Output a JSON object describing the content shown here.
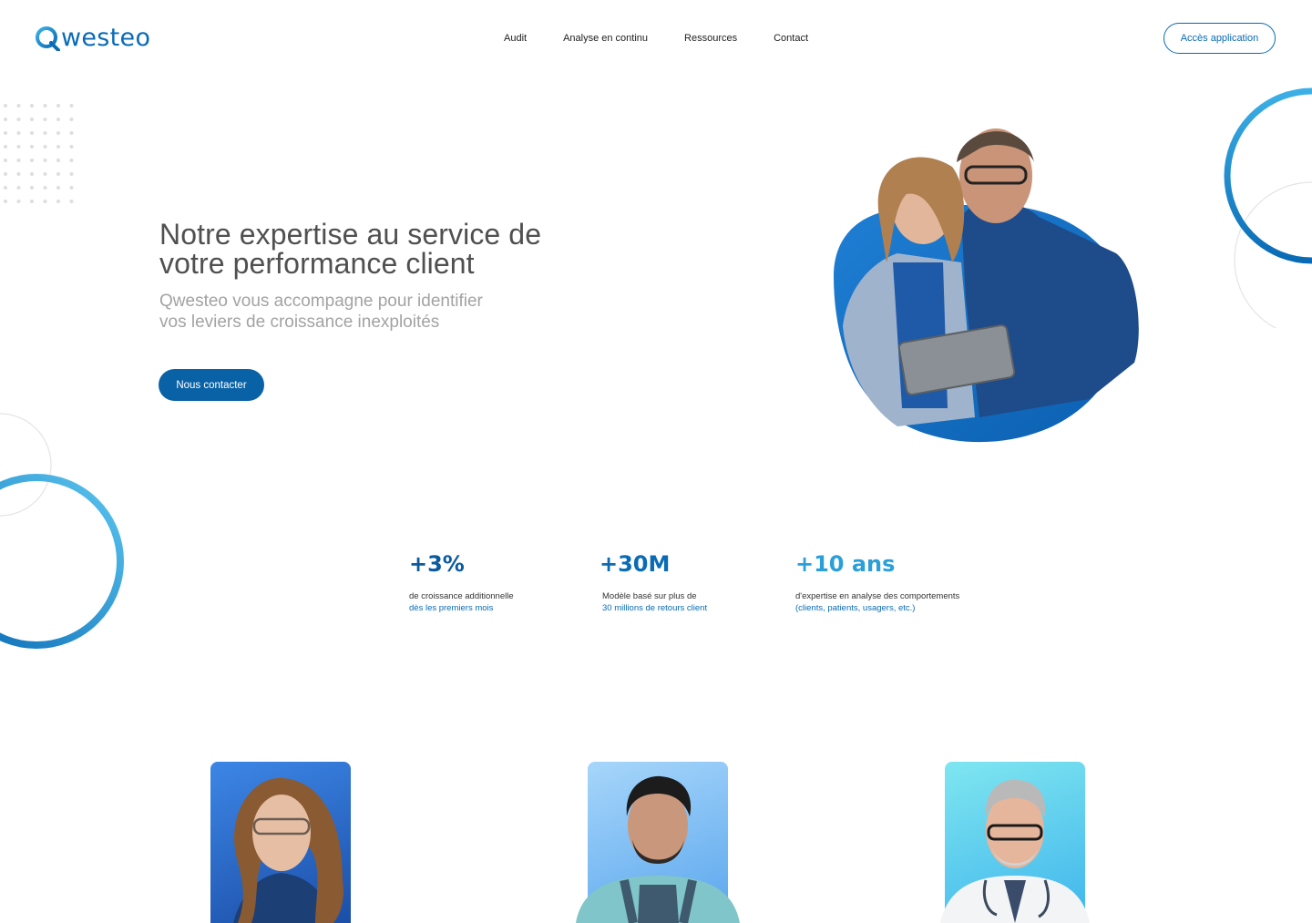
{
  "brand": {
    "name": "westeo",
    "accent": "#0a6bb5",
    "accent_light": "#3cb0e6"
  },
  "nav": {
    "items": [
      "Audit",
      "Analyse en continu",
      "Ressources",
      "Contact"
    ]
  },
  "header": {
    "app_button": "Accès application"
  },
  "hero": {
    "title_line1": "Notre expertise au service de",
    "title_line2": "votre performance client",
    "subtitle_line1": "Qwesteo vous accompagne pour identifier",
    "subtitle_line2": "vos leviers de croissance inexploités",
    "cta": "Nous contacter"
  },
  "stats": [
    {
      "value": "+3%",
      "line1": "de croissance additionnelle",
      "line2": "dès les premiers mois",
      "color": "#0a5aa0"
    },
    {
      "value": "+30M",
      "line1": "Modèle basé sur plus de",
      "line2": "30 millions de retours client",
      "color": "#0a6bb5"
    },
    {
      "value": "+10 ans",
      "line1": "d'expertise en analyse des comportements",
      "line2": "(clients, patients, usagers, etc.)",
      "color": "#2a9fd8"
    }
  ],
  "personas": [
    {
      "icon": "woman-portrait",
      "bg": "#2f6fd0"
    },
    {
      "icon": "man-apron-portrait",
      "bg": "#6fb9f0"
    },
    {
      "icon": "doctor-portrait",
      "bg": "#5fd0ef"
    }
  ]
}
